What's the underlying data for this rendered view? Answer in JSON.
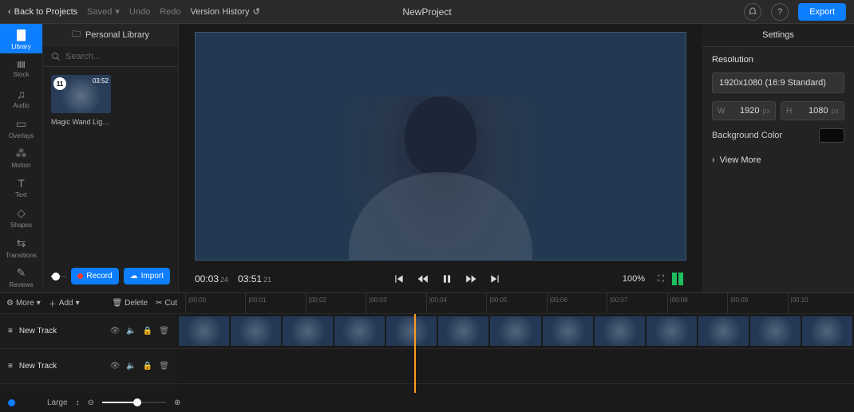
{
  "topbar": {
    "back_label": "Back to Projects",
    "saved_label": "Saved",
    "undo_label": "Undo",
    "redo_label": "Redo",
    "version_label": "Version History",
    "project_title": "NewProject",
    "export_label": "Export"
  },
  "tools": {
    "library": "Library",
    "stock": "Stock",
    "audio": "Audio",
    "overlays": "Overlays",
    "motion": "Motion",
    "text": "Text",
    "shapes": "Shapes",
    "transitions": "Transitions",
    "reviews": "Reviews"
  },
  "library": {
    "panel_title": "Personal Library",
    "search_placeholder": "Search...",
    "clip": {
      "badge": "11",
      "duration": "03:52",
      "name": "Magic Wand Light..."
    }
  },
  "actions": {
    "record": "Record",
    "import": "Import"
  },
  "preview": {
    "current_time": "00:03",
    "current_frames": "24",
    "total_time": "03:51",
    "total_frames": "21",
    "zoom": "100%"
  },
  "settings": {
    "title": "Settings",
    "resolution_title": "Resolution",
    "resolution_value": "1920x1080 (16:9 Standard)",
    "w_label": "W",
    "w_value": "1920",
    "w_unit": "px",
    "h_label": "H",
    "h_value": "1080",
    "h_unit": "px",
    "bg_label": "Background Color",
    "view_more": "View More"
  },
  "timeline": {
    "more_label": "More",
    "add_label": "Add",
    "delete_label": "Delete",
    "cut_label": "Cut",
    "track_a": "New Track",
    "track_b": "New Track",
    "ticks": [
      "|00:00",
      "|00:01",
      "|00:02",
      "|00:03",
      "|00:04",
      "|00:05",
      "|00:06",
      "|00:07",
      "|00:08",
      "|00:09",
      "|00:10"
    ],
    "zoom_label": "Large"
  }
}
